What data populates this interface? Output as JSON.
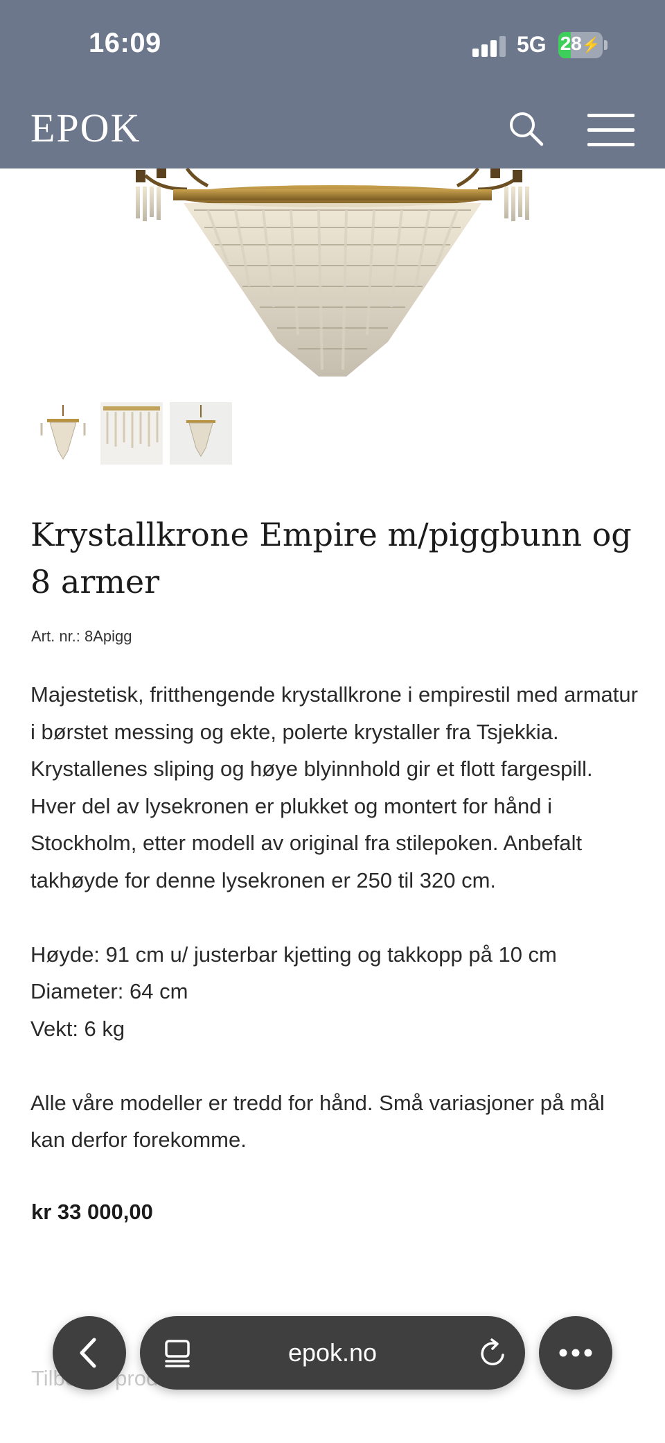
{
  "status_bar": {
    "time": "16:09",
    "network": "5G",
    "battery_level": "28",
    "battery_fraction": 0.28,
    "signal_bars_active": 3
  },
  "header": {
    "logo": "EPOK",
    "search_icon": "search-icon",
    "menu_icon": "hamburger-menu-icon",
    "background_color": "#6c778c"
  },
  "gallery": {
    "main_image": "chandelier-image",
    "thumbnails": [
      "chandelier-thumbnail-1",
      "chandelier-thumbnail-2",
      "chandelier-thumbnail-3"
    ]
  },
  "product": {
    "title": "Krystallkrone Empire m/piggbunn og 8 armer",
    "art_nr": "Art. nr.: 8Apigg",
    "description": [
      "Majestetisk, fritthengende krystallkrone i empirestil med armatur i børstet messing og ekte, polerte krystaller fra Tsjekkia. Krystallenes sliping og høye blyinnhold gir et flott fargespill. Hver del av lysekronen er plukket og montert for hånd i Stockholm, etter modell av original fra stilepoken. Anbefalt takhøyde for denne lysekronen er 250 til 320 cm."
    ],
    "specs": [
      "Høyde: 91 cm u/ justerbar kjetting og takkopp på 10 cm",
      "Diameter: 64 cm",
      "Vekt: 6 kg"
    ],
    "note": "Alle våre modeller er tredd for hånd. Små variasjoner på mål kan derfor forekomme.",
    "price": "kr 33 000,00"
  },
  "below_fold": {
    "faded_heading": "Tilbehør produkt"
  },
  "browser_bar": {
    "url": "epok.no",
    "back_icon": "chevron-left-icon",
    "tabs_icon": "tabs-icon",
    "reload_icon": "reload-icon",
    "more_icon": "more-dots-icon"
  }
}
